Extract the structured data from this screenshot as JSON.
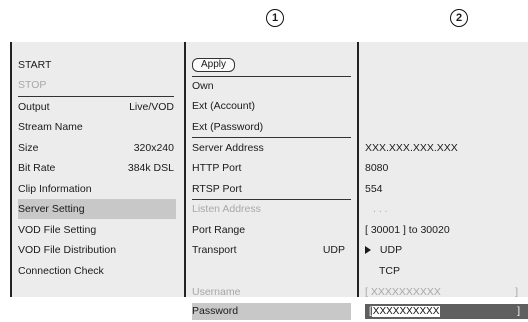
{
  "callouts": {
    "one": "1",
    "two": "2"
  },
  "left_menu": {
    "items": [
      {
        "label": "START",
        "value": ""
      },
      {
        "label": "STOP",
        "value": ""
      },
      {
        "label": "Output",
        "value": "Live/VOD"
      },
      {
        "label": "Stream Name",
        "value": ""
      },
      {
        "label": "Size",
        "value": "320x240"
      },
      {
        "label": "Bit Rate",
        "value": "384k DSL"
      },
      {
        "label": "Clip Information",
        "value": ""
      },
      {
        "label": "Server Setting",
        "value": ""
      },
      {
        "label": "VOD File Setting",
        "value": ""
      },
      {
        "label": "VOD File Distribution",
        "value": ""
      },
      {
        "label": "Connection Check",
        "value": ""
      }
    ]
  },
  "mid_menu": {
    "apply_label": "Apply",
    "items": [
      {
        "label": "Own"
      },
      {
        "label": "Ext (Account)"
      },
      {
        "label": "Ext (Password)"
      },
      {
        "label": "Server Address"
      },
      {
        "label": "HTTP Port"
      },
      {
        "label": "RTSP Port"
      },
      {
        "label": "Listen Address"
      },
      {
        "label": "Port Range"
      },
      {
        "label": "Transport",
        "value": "UDP"
      },
      {
        "label": "Username"
      },
      {
        "label": "Password"
      }
    ]
  },
  "right_values": {
    "server_address": "XXX.XXX.XXX.XXX",
    "http_port": "8080",
    "rtsp_port": "554",
    "listen_address": ". . .",
    "port_range": "[ 30001 ] to 30020",
    "transport_udp": "UDP",
    "transport_tcp": "TCP",
    "username_open": "[ XXXXXXXXXX",
    "username_close": "]",
    "password_open": "[",
    "password_value": "XXXXXXXXXX",
    "password_close": "]"
  }
}
